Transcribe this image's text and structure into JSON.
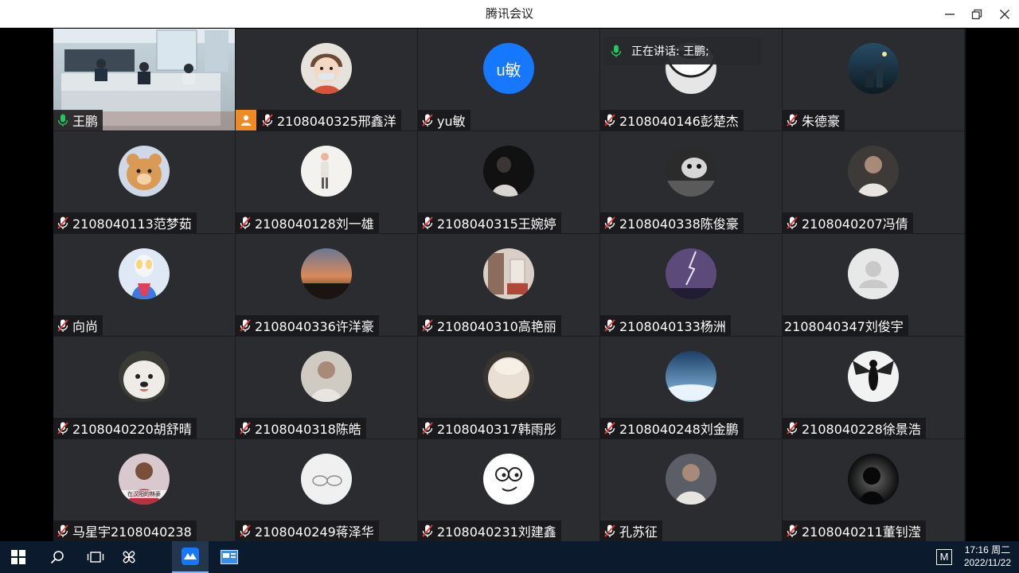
{
  "window": {
    "title": "腾讯会议"
  },
  "speaking_indicator": {
    "label": "正在讲话: 王鹏;"
  },
  "participants": [
    {
      "name": "王鹏",
      "mic": "on",
      "kind": "video"
    },
    {
      "name": "2108040325邢鑫洋",
      "mic": "muted",
      "host": true,
      "avatar_color": "#c9b7a5",
      "avatar_style": "cartoon-boy"
    },
    {
      "name": "yu敏",
      "mic": "muted",
      "avatar_text": "u敏",
      "avatar_color": "#1677ff"
    },
    {
      "name": "2108040146彭楚杰",
      "mic": "muted",
      "avatar_color": "#e6e6e6",
      "avatar_style": "smile"
    },
    {
      "name": "朱德豪",
      "mic": "muted",
      "avatar_color": "#2c4a5c",
      "avatar_style": "night-city"
    },
    {
      "name": "2108040113范梦茹",
      "mic": "muted",
      "avatar_color": "#d89a55",
      "avatar_style": "bear"
    },
    {
      "name": "2108040128刘一雄",
      "mic": "muted",
      "avatar_color": "#f4f2ee",
      "avatar_style": "figure-white"
    },
    {
      "name": "2108040315王婉婷",
      "mic": "muted",
      "avatar_color": "#111111",
      "avatar_style": "dark-portrait"
    },
    {
      "name": "2108040338陈俊豪",
      "mic": "muted",
      "avatar_color": "#7d7d7d",
      "avatar_style": "bw-photo"
    },
    {
      "name": "2108040207冯倩",
      "mic": "muted",
      "avatar_color": "#3d3a38",
      "avatar_style": "photo-person"
    },
    {
      "name": "向尚",
      "mic": "muted",
      "avatar_color": "#dfe8f5",
      "avatar_style": "ultraman"
    },
    {
      "name": "2108040336许洋豪",
      "mic": "muted",
      "avatar_color": "#c7714a",
      "avatar_style": "sunset"
    },
    {
      "name": "2108040310高艳丽",
      "mic": "muted",
      "avatar_color": "#9a7a6a",
      "avatar_style": "room"
    },
    {
      "name": "2108040133杨洲",
      "mic": "muted",
      "avatar_color": "#5b4a7a",
      "avatar_style": "lightning"
    },
    {
      "name": "2108040347刘俊宇",
      "mic": "none",
      "avatar_color": "#e8e8e8",
      "avatar_style": "default"
    },
    {
      "name": "2108040220胡舒晴",
      "mic": "muted",
      "avatar_color": "#efece8",
      "avatar_style": "dog"
    },
    {
      "name": "2108040318陈皓",
      "mic": "muted",
      "avatar_color": "#cfcac2",
      "avatar_style": "photo-person"
    },
    {
      "name": "2108040317韩雨彤",
      "mic": "muted",
      "avatar_color": "#e9dfd3",
      "avatar_style": "fluffy"
    },
    {
      "name": "2108040248刘金鹏",
      "mic": "muted",
      "avatar_color": "#2f6da0",
      "avatar_style": "sky"
    },
    {
      "name": "2108040228徐景浩",
      "mic": "muted",
      "avatar_color": "#f2f2f2",
      "avatar_style": "insect"
    },
    {
      "name": "马星宇2108040238",
      "mic": "muted",
      "avatar_color": "#b8313f",
      "avatar_style": "player",
      "avatar_caption": "在汉阳的林豪"
    },
    {
      "name": "2108040249蒋泽华",
      "mic": "muted",
      "avatar_color": "#f0f0f0",
      "avatar_style": "sketch"
    },
    {
      "name": "2108040231刘建鑫",
      "mic": "muted",
      "avatar_color": "#ffffff",
      "avatar_style": "meme-face"
    },
    {
      "name": "孔苏征",
      "mic": "muted",
      "avatar_color": "#5b5e66",
      "avatar_style": "photo-person"
    },
    {
      "name": "2108040211董钊滢",
      "mic": "muted",
      "avatar_color": "#1a1a1a",
      "avatar_style": "silhouette"
    }
  ],
  "taskbar": {
    "items": [
      "windows-start",
      "search",
      "task-view",
      "app-pinwheel",
      "tencent-meeting",
      "app-window"
    ],
    "ime": "M",
    "time": "17:16 周二",
    "date": "2022/11/22"
  },
  "colors": {
    "grid_bg": "#2b2c2f",
    "taskbar_bg": "#0b1a2c",
    "mic_on": "#22c55e",
    "host_badge": "#f08a24",
    "accent": "#1677ff"
  }
}
